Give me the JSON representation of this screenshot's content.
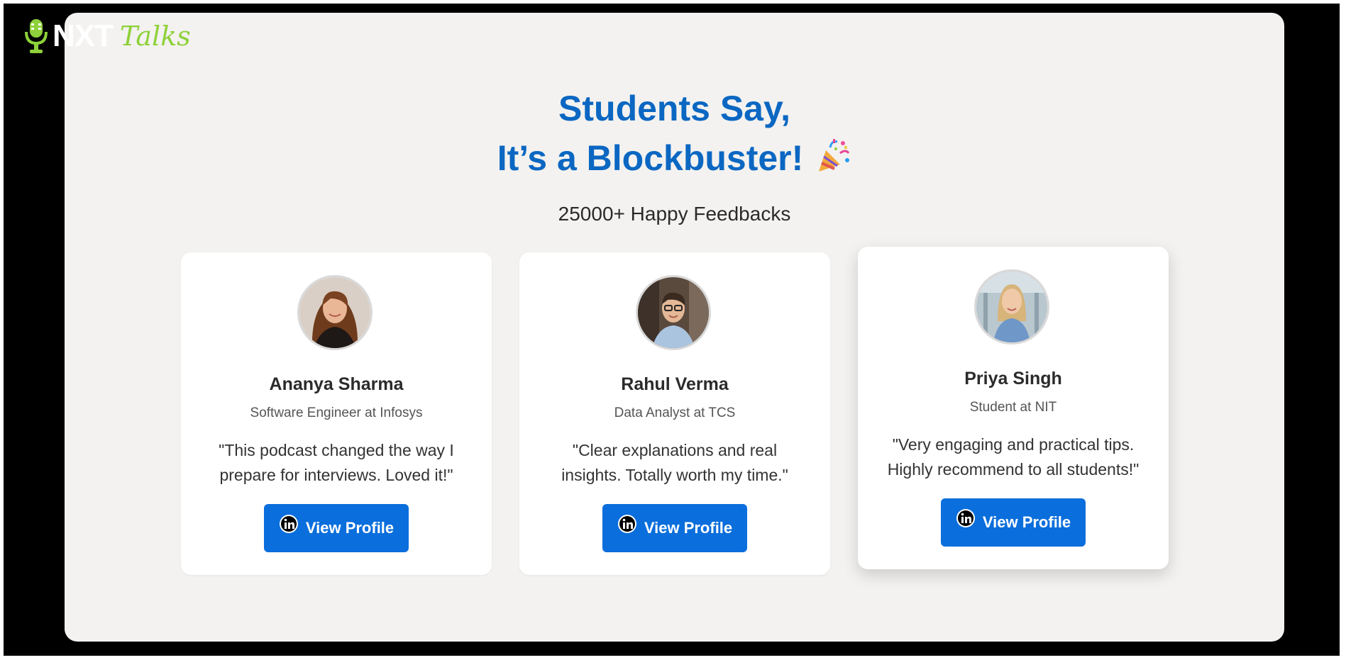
{
  "brand": {
    "logo_mark": "NXT",
    "logo_script": "Talks",
    "icon": "microphone-icon",
    "colors": {
      "white": "#ffffff",
      "green": "#8ed13a"
    }
  },
  "hero": {
    "title_line1": "Students Say,",
    "title_line2": "It’s a Blockbuster!",
    "title_icon": "party-popper-icon",
    "subtitle": "25000+ Happy Feedbacks"
  },
  "testimonials": [
    {
      "name": "Ananya Sharma",
      "role": "Software Engineer at Infosys",
      "quote": "\"This podcast changed the way I prepare for interviews. Loved it!\"",
      "button_label": "View Profile",
      "button_icon": "linkedin-icon"
    },
    {
      "name": "Rahul Verma",
      "role": "Data Analyst at TCS",
      "quote": "\"Clear explanations and real insights. Totally worth my time.\"",
      "button_label": "View Profile",
      "button_icon": "linkedin-icon"
    },
    {
      "name": "Priya Singh",
      "role": "Student at NIT",
      "quote": "\"Very engaging and practical tips. Highly recommend to all students!\"",
      "button_label": "View Profile",
      "button_icon": "linkedin-icon"
    }
  ],
  "colors": {
    "frame": "#000000",
    "background": "#f3f2f0",
    "heading": "#0b67c2",
    "button": "#0a6edc",
    "card": "#ffffff"
  }
}
